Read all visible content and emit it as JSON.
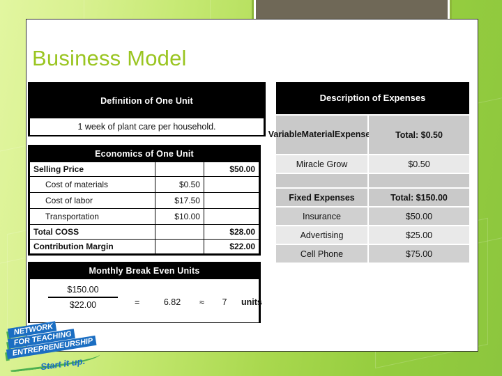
{
  "slide": {
    "title": "Business Model",
    "title_color": "#9ac521",
    "accent_green": "#8cc63e",
    "deco_brown": "#6f6857"
  },
  "definition_table": {
    "header": "Definition of One Unit",
    "value": "1 week of plant care per household."
  },
  "economics_table": {
    "header": "Economics of One Unit",
    "rows": [
      {
        "label": "Selling Price",
        "mid": "",
        "right": "$50.00",
        "bold": true,
        "indent": false
      },
      {
        "label": "Cost of materials",
        "mid": "$0.50",
        "right": "",
        "bold": false,
        "indent": true
      },
      {
        "label": "Cost of labor",
        "mid": "$17.50",
        "right": "",
        "bold": false,
        "indent": true
      },
      {
        "label": "Transportation",
        "mid": "$10.00",
        "right": "",
        "bold": false,
        "indent": true
      },
      {
        "label": "Total COSS",
        "mid": "",
        "right": "$28.00",
        "bold": true,
        "indent": false
      },
      {
        "label": "Contribution Margin",
        "mid": "",
        "right": "$22.00",
        "bold": true,
        "indent": false
      }
    ]
  },
  "breakeven_table": {
    "header": "Monthly Break Even Units",
    "numerator": "$150.00",
    "denominator": "$22.00",
    "equals_sign": "=",
    "quotient": "6.82",
    "approx_sign": "≈",
    "rounded": "7",
    "units_label": "units"
  },
  "expenses_table": {
    "header": "Description of Expenses",
    "rows": [
      {
        "label": "Variable\nMaterial\nExpenses",
        "value": "Total:  $0.50",
        "style": "section-tall"
      },
      {
        "label": "Miracle Grow",
        "value": "$0.50",
        "style": "data-light"
      },
      {
        "label": "",
        "value": "",
        "style": "spacer"
      },
      {
        "label": "Fixed Expenses",
        "value": "Total:  $150.00",
        "style": "section"
      },
      {
        "label": "Insurance",
        "value": "$50.00",
        "style": "data-mid"
      },
      {
        "label": "Advertising",
        "value": "$25.00",
        "style": "data-light"
      },
      {
        "label": "Cell Phone",
        "value": "$75.00",
        "style": "data-mid"
      }
    ]
  },
  "logo": {
    "line1": "NETWORK",
    "line2": "FOR TEACHING",
    "line3": "ENTREPRENEURSHIP",
    "tagline": "Start it up."
  }
}
